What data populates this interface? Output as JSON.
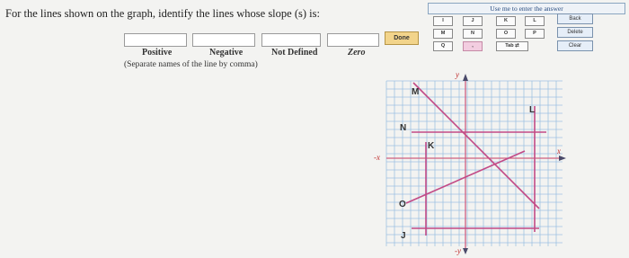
{
  "question": "For the lines shown on the graph, identify the lines whose slope (s) is:",
  "answer_labels": [
    "Positive",
    "Negative",
    "Not Defined",
    "Zero"
  ],
  "hint": "(Separate names of the line by comma)",
  "done_label": "Done",
  "keyboard": {
    "title": "Use me to enter the answer",
    "row1": [
      "I",
      "J",
      "K",
      "L"
    ],
    "row2": [
      "M",
      "N",
      "O",
      "P"
    ],
    "row3_first": "Q",
    "row3_comma": ",",
    "tab_label": "Tab",
    "tab_arrows": "⇄",
    "side": [
      "Back",
      "Delete",
      "Clear"
    ]
  },
  "graph": {
    "line_labels": {
      "M": "M",
      "N": "N",
      "K": "K",
      "L": "L",
      "O": "O",
      "J": "J"
    },
    "y_axis": "y",
    "neg_x_axis": "-x",
    "x_axis": "x",
    "neg_y_axis": "-y"
  },
  "colors": {
    "grid": "#9fc2e2",
    "axis": "#d06080",
    "lines": "#c24a86",
    "done_bg": "#f2d48b",
    "kb_border": "#8aa5c0"
  }
}
